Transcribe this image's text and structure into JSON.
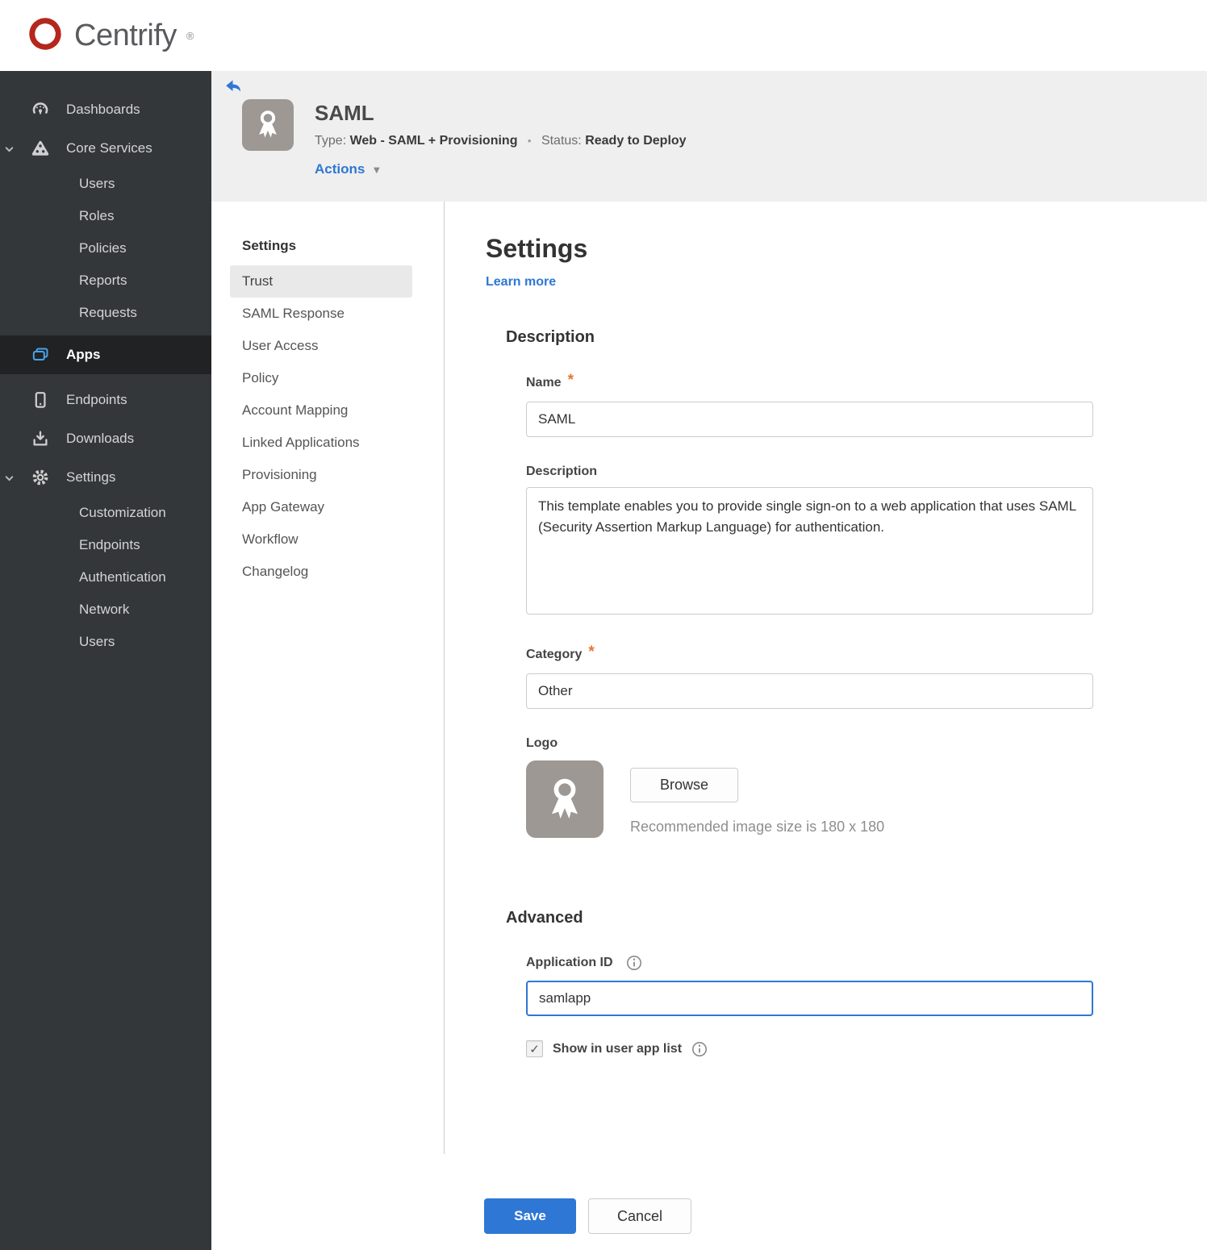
{
  "brand": {
    "name": "Centrify",
    "registered": "®"
  },
  "icons": {
    "caret_down": "▼",
    "checkbox_check": "✓",
    "separator_dot": "•",
    "required_marker": "*"
  },
  "sidebar": {
    "items": [
      {
        "label": "Dashboards",
        "icon": "gauge-icon"
      },
      {
        "label": "Core Services",
        "icon": "core-services-icon",
        "expanded": true,
        "children": [
          "Users",
          "Roles",
          "Policies",
          "Reports",
          "Requests"
        ]
      },
      {
        "label": "Apps",
        "icon": "apps-icon",
        "active": true
      },
      {
        "label": "Endpoints",
        "icon": "device-icon"
      },
      {
        "label": "Downloads",
        "icon": "download-icon"
      },
      {
        "label": "Settings",
        "icon": "gear-icon",
        "expanded": true,
        "children": [
          "Customization",
          "Endpoints",
          "Authentication",
          "Network",
          "Users"
        ]
      }
    ]
  },
  "header": {
    "title": "SAML",
    "type_label": "Type:",
    "type_value": "Web - SAML + Provisioning",
    "status_label": "Status:",
    "status_value": "Ready to Deploy",
    "actions_label": "Actions"
  },
  "subnav": {
    "title": "Settings",
    "active_item": "Trust",
    "items": [
      "Trust",
      "SAML Response",
      "User Access",
      "Policy",
      "Account Mapping",
      "Linked Applications",
      "Provisioning",
      "App Gateway",
      "Workflow",
      "Changelog"
    ]
  },
  "main": {
    "title": "Settings",
    "learn_more": "Learn more",
    "description_section": {
      "heading": "Description",
      "name_label": "Name",
      "name_value": "SAML",
      "description_label": "Description",
      "description_value": "This template enables you to provide single sign-on to a web application that uses SAML (Security Assertion Markup Language) for authentication.",
      "category_label": "Category",
      "category_value": "Other",
      "logo_label": "Logo",
      "browse_label": "Browse",
      "logo_hint": "Recommended image size is 180 x 180"
    },
    "advanced_section": {
      "heading": "Advanced",
      "app_id_label": "Application ID",
      "app_id_value": "samlapp",
      "show_in_list_label": "Show in user app list",
      "show_in_list_checked": true
    },
    "footer": {
      "save_label": "Save",
      "cancel_label": "Cancel"
    }
  },
  "colors": {
    "accent_blue": "#2e77d4",
    "status_red": "#a51f17",
    "required_orange": "#e8742c",
    "sidebar_bg": "#34373a",
    "sidebar_active_bg": "#202224",
    "header_band_bg": "#efefef",
    "avatar_gray": "#9d9893",
    "brand_red": "#b5271d"
  }
}
